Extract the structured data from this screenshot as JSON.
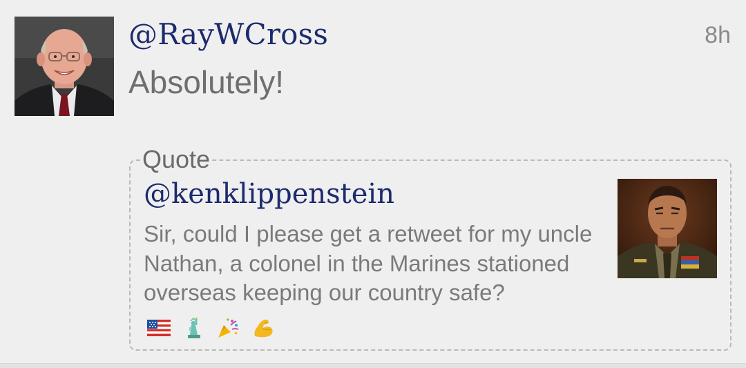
{
  "tweet": {
    "handle": "@RayWCross",
    "time": "8h",
    "message": "Absolutely!",
    "avatar_alt": "profile photo of a bald man in a suit"
  },
  "quote": {
    "label": "Quote",
    "handle": "@kenklippenstein",
    "text": "Sir, could I please get a retweet for my uncle Nathan, a colonel in the Marines stationed overseas keeping our country safe?",
    "emojis": [
      "flag-us-icon",
      "statue-of-liberty-icon",
      "party-popper-icon",
      "flexed-biceps-icon"
    ],
    "avatar_alt": "photo of a man in a military uniform"
  },
  "colors": {
    "background": "#efefef",
    "handle": "#1c2a6e",
    "message": "#6f6f6f",
    "quote_text": "#7a7a7a",
    "border": "#b9b9b9"
  }
}
